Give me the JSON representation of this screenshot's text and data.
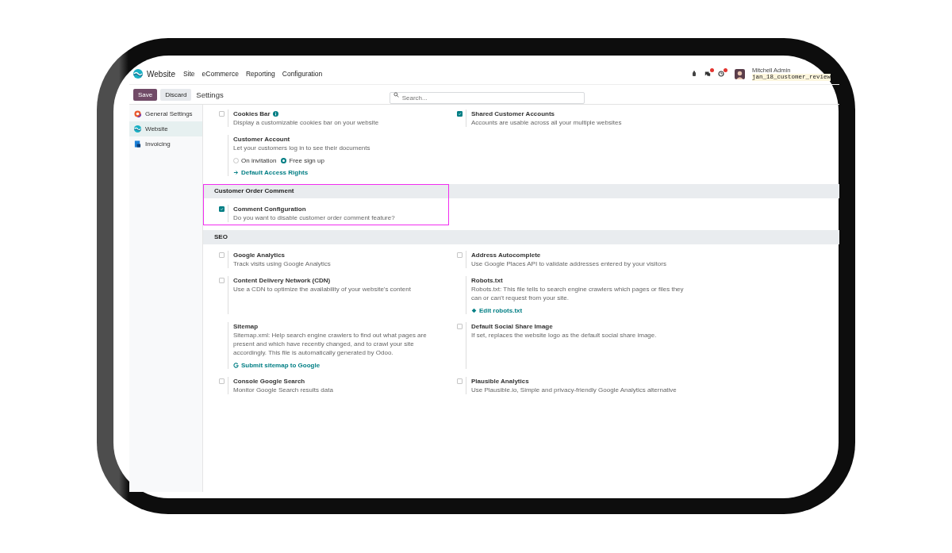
{
  "navbar": {
    "app_name": "Website",
    "menus": [
      "Site",
      "eCommerce",
      "Reporting",
      "Configuration"
    ],
    "user": {
      "name": "Mitchell Admin",
      "database": "jan_18_customer_review"
    }
  },
  "control_bar": {
    "save": "Save",
    "discard": "Discard",
    "breadcrumb": "Settings",
    "search": {
      "placeholder": "Search..."
    }
  },
  "sidebar": {
    "items": [
      {
        "label": "General Settings",
        "selected": false,
        "kind": "general"
      },
      {
        "label": "Website",
        "selected": true,
        "kind": "website"
      },
      {
        "label": "Invoicing",
        "selected": false,
        "kind": "invoicing"
      }
    ]
  },
  "sections": [
    {
      "items": [
        {
          "kind": "checkbox",
          "title": "Cookies Bar",
          "info": true,
          "checked": false,
          "description": "Display a customizable cookies bar on your website"
        },
        {
          "kind": "checkbox",
          "title": "Shared Customer Accounts",
          "checked": true,
          "description": "Accounts are usable across all your multiple websites"
        },
        {
          "kind": "radio",
          "title": "Customer Account",
          "description": "Let your customers log in to see their documents",
          "options": [
            {
              "label": "On invitation",
              "selected": false
            },
            {
              "label": "Free sign up",
              "selected": true
            }
          ],
          "link": {
            "kind": "arrow",
            "label": "Default Access Rights"
          }
        }
      ]
    },
    {
      "title": "Customer Order Comment",
      "highlighted": true,
      "items": [
        {
          "kind": "checkbox",
          "title": "Comment Configuration",
          "checked": true,
          "description": "Do you want to disable customer order comment feature?"
        }
      ]
    },
    {
      "title": "SEO",
      "highlighted": false,
      "items": [
        {
          "kind": "checkbox",
          "title": "Google Analytics",
          "checked": false,
          "description": "Track visits using Google Analytics"
        },
        {
          "kind": "checkbox",
          "title": "Address Autocomplete",
          "checked": false,
          "description": "Use Google Places API to validate addresses entered by your visitors"
        },
        {
          "kind": "checkbox",
          "title": "Content Delivery Network (CDN)",
          "checked": false,
          "description": "Use a CDN to optimize the availability of your website's content"
        },
        {
          "kind": "plain",
          "title": "Robots.txt",
          "description": "Robots.txt: This file tells to search engine crawlers which pages or files they can or can't request from your site.",
          "link": {
            "kind": "diamond",
            "label": "Edit robots.txt"
          }
        },
        {
          "kind": "plain",
          "title": "Sitemap",
          "description": "Sitemap.xml: Help search engine crawlers to find out what pages are present and which have recently changed, and to crawl your site accordingly. This file is automatically generated by Odoo.",
          "link": {
            "kind": "google",
            "label": "Submit sitemap to Google"
          }
        },
        {
          "kind": "checkbox",
          "title": "Default Social Share Image",
          "checked": false,
          "description": "If set, replaces the website logo as the default social share image."
        },
        {
          "kind": "checkbox",
          "title": "Console Google Search",
          "checked": false,
          "description": "Monitor Google Search results data"
        },
        {
          "kind": "checkbox",
          "title": "Plausible Analytics",
          "checked": false,
          "description": "Use Plausible.io, Simple and privacy-friendly Google Analytics alternative"
        }
      ]
    }
  ]
}
